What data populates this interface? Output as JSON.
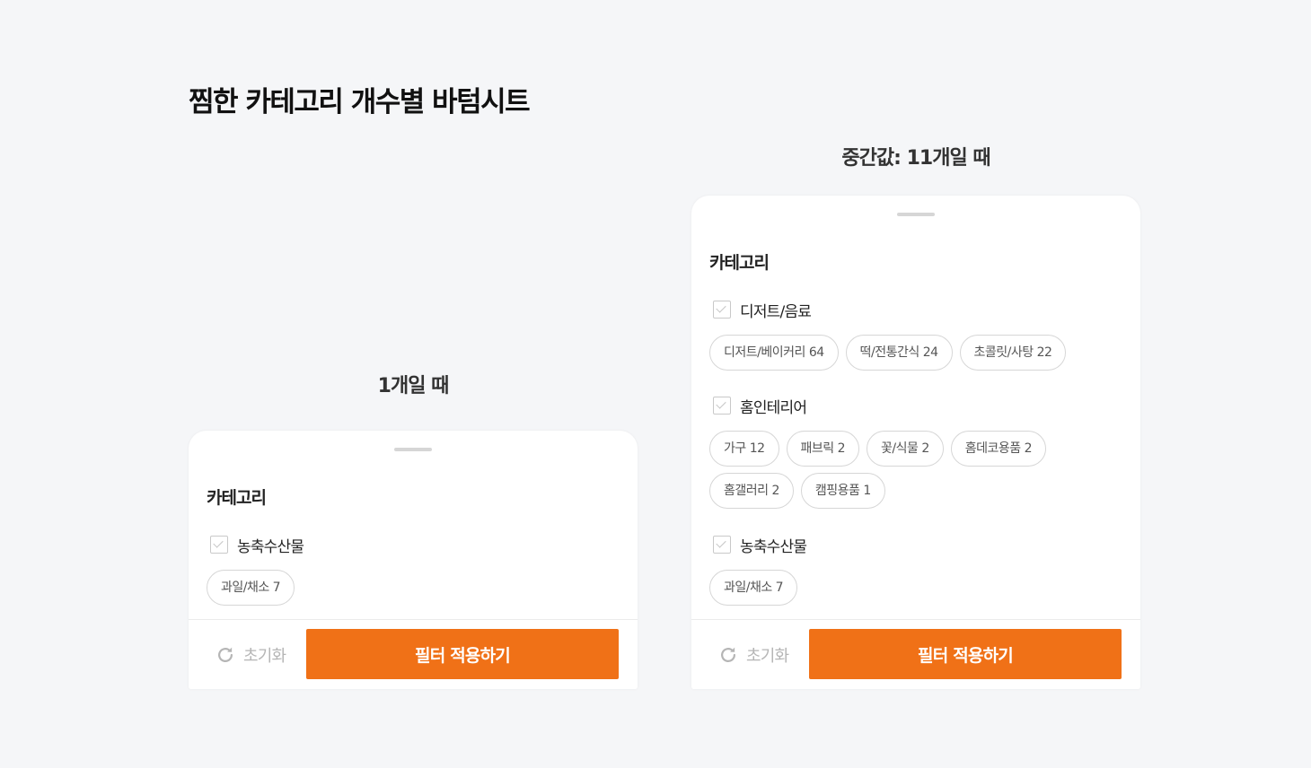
{
  "page": {
    "title": "찜한 카테고리 개수별 바텀시트"
  },
  "left": {
    "caption": "1개일 때",
    "sheet_title": "카테고리",
    "groups": [
      {
        "label": "농축수산물",
        "chips": [
          "과일/채소 7"
        ]
      }
    ],
    "reset_label": "초기화",
    "apply_label": "필터 적용하기"
  },
  "right": {
    "caption": "중간값: 11개일 때",
    "sheet_title": "카테고리",
    "groups": [
      {
        "label": "디저트/음료",
        "chips": [
          "디저트/베이커리 64",
          "떡/전통간식 24",
          "초콜릿/사탕 22"
        ]
      },
      {
        "label": "홈인테리어",
        "chips": [
          "가구 12",
          "패브릭 2",
          "꽃/식물 2",
          "홈데코용품 2",
          "홈갤러리 2",
          "캠핑용품 1"
        ]
      },
      {
        "label": "농축수산물",
        "chips": [
          "과일/채소 7"
        ]
      }
    ],
    "reset_label": "초기화",
    "apply_label": "필터 적용하기"
  },
  "colors": {
    "accent": "#f07117",
    "background": "#f5f6f8",
    "chip_border": "#d6d6d6",
    "reset_text": "#b5b5b5"
  },
  "icons": {
    "reset": "refresh-icon",
    "checkbox": "checkbox-checked-icon",
    "handle": "drag-handle"
  }
}
